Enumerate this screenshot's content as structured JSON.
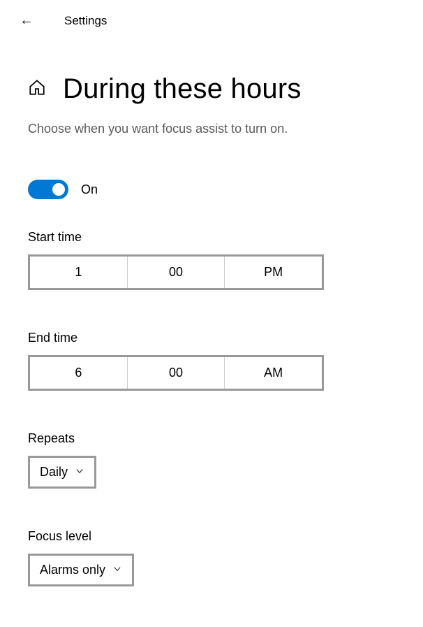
{
  "header": {
    "back_icon": "←",
    "title": "Settings"
  },
  "page": {
    "title": "During these hours",
    "subtitle": "Choose when you want focus assist to turn on."
  },
  "toggle": {
    "state": "On",
    "enabled": true
  },
  "start_time": {
    "label": "Start time",
    "hour": "1",
    "minute": "00",
    "period": "PM"
  },
  "end_time": {
    "label": "End time",
    "hour": "6",
    "minute": "00",
    "period": "AM"
  },
  "repeats": {
    "label": "Repeats",
    "value": "Daily"
  },
  "focus_level": {
    "label": "Focus level",
    "value": "Alarms only"
  },
  "colors": {
    "accent": "#0078d4",
    "border": "#999999"
  }
}
